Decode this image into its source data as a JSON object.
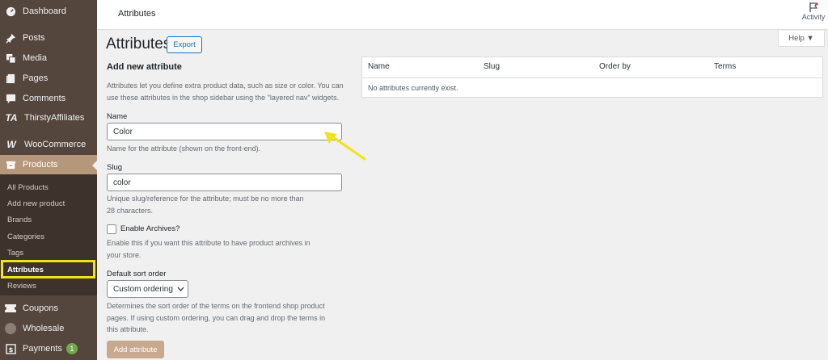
{
  "sidebar": {
    "top_items": [
      {
        "label": "Dashboard",
        "icon": "dashboard-icon"
      },
      {
        "label": "Posts",
        "icon": "pin-icon"
      },
      {
        "label": "Media",
        "icon": "media-icon"
      },
      {
        "label": "Pages",
        "icon": "pages-icon"
      },
      {
        "label": "Comments",
        "icon": "comments-icon"
      },
      {
        "label": "ThirstyAffiliates",
        "icon_text": "TA"
      },
      {
        "label": "WooCommerce",
        "icon_text": "W"
      },
      {
        "label": "Products",
        "icon": "products-icon"
      }
    ],
    "submenu": [
      "All Products",
      "Add new product",
      "Brands",
      "Categories",
      "Tags",
      "Attributes",
      "Reviews"
    ],
    "bottom_items": [
      {
        "label": "Coupons",
        "icon": "coupons-icon"
      },
      {
        "label": "Wholesale",
        "icon": "wholesale-icon"
      },
      {
        "label": "Payments",
        "icon": "payments-icon",
        "badge": "1"
      }
    ],
    "highlight_color": "#f1e21c",
    "bg_color": "#54463d",
    "active_color": "#b5977b"
  },
  "topbar": {
    "title": "Attributes",
    "activity_label": "Activity"
  },
  "help_label": "Help ▼",
  "page": {
    "title": "Attributes",
    "export_label": "Export"
  },
  "form": {
    "heading": "Add new attribute",
    "intro_line1": "Attributes let you define extra product data, such as size or color. You can",
    "intro_line2": "use these attributes in the shop sidebar using the \"layered nav\" widgets.",
    "name_label": "Name",
    "name_value": "Color",
    "name_help": "Name for the attribute (shown on the front-end).",
    "slug_label": "Slug",
    "slug_value": "color",
    "slug_help_line1": "Unique slug/reference for the attribute; must be no more than",
    "slug_help_line2": "28 characters.",
    "archives_label": "Enable Archives?",
    "archives_help_line1": "Enable this if you want this attribute to have product archives in",
    "archives_help_line2": "your store.",
    "sort_label": "Default sort order",
    "sort_value": "Custom ordering",
    "sort_help_line1": "Determines the sort order of the terms on the frontend shop product",
    "sort_help_line2": "pages. If using custom ordering, you can drag and drop the terms in",
    "sort_help_line3": "this attribute.",
    "submit_label": "Add attribute"
  },
  "table": {
    "columns": [
      "Name",
      "Slug",
      "Order by",
      "Terms"
    ],
    "empty_message": "No attributes currently exist."
  },
  "annotation": {
    "arrow_color": "#f1e21c"
  }
}
